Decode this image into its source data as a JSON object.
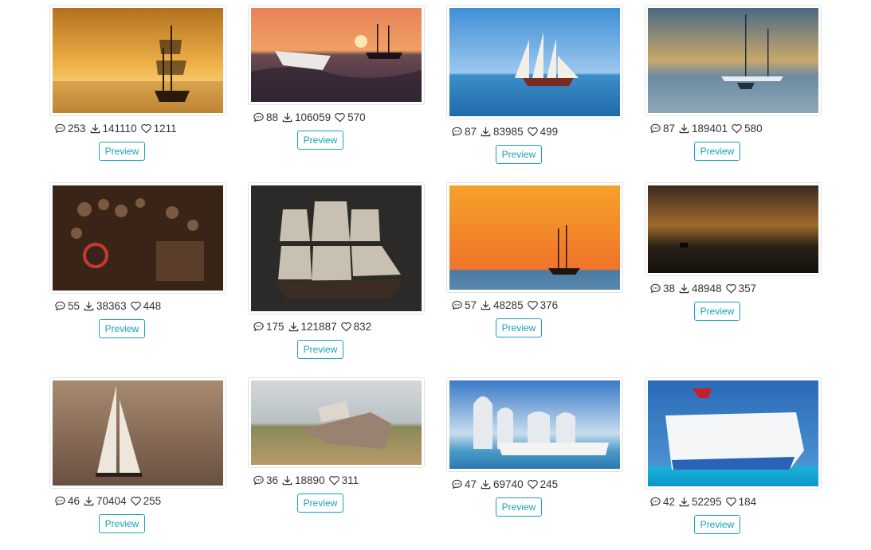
{
  "gallery": {
    "preview_label": "Preview",
    "items": [
      {
        "comments": "253",
        "downloads": "141110",
        "likes": "1211"
      },
      {
        "comments": "88",
        "downloads": "106059",
        "likes": "570"
      },
      {
        "comments": "87",
        "downloads": "83985",
        "likes": "499"
      },
      {
        "comments": "87",
        "downloads": "189401",
        "likes": "580"
      },
      {
        "comments": "55",
        "downloads": "38363",
        "likes": "448"
      },
      {
        "comments": "175",
        "downloads": "121887",
        "likes": "832"
      },
      {
        "comments": "57",
        "downloads": "48285",
        "likes": "376"
      },
      {
        "comments": "38",
        "downloads": "48948",
        "likes": "357"
      },
      {
        "comments": "46",
        "downloads": "70404",
        "likes": "255"
      },
      {
        "comments": "36",
        "downloads": "18890",
        "likes": "311"
      },
      {
        "comments": "47",
        "downloads": "69740",
        "likes": "245"
      },
      {
        "comments": "42",
        "downloads": "52295",
        "likes": "184"
      }
    ]
  },
  "icons": {
    "comments": "speech-bubble-icon",
    "downloads": "download-icon",
    "likes": "heart-icon"
  },
  "colors": {
    "accent": "#17a2b8",
    "text": "#333333",
    "border": "#e3e3e3"
  }
}
